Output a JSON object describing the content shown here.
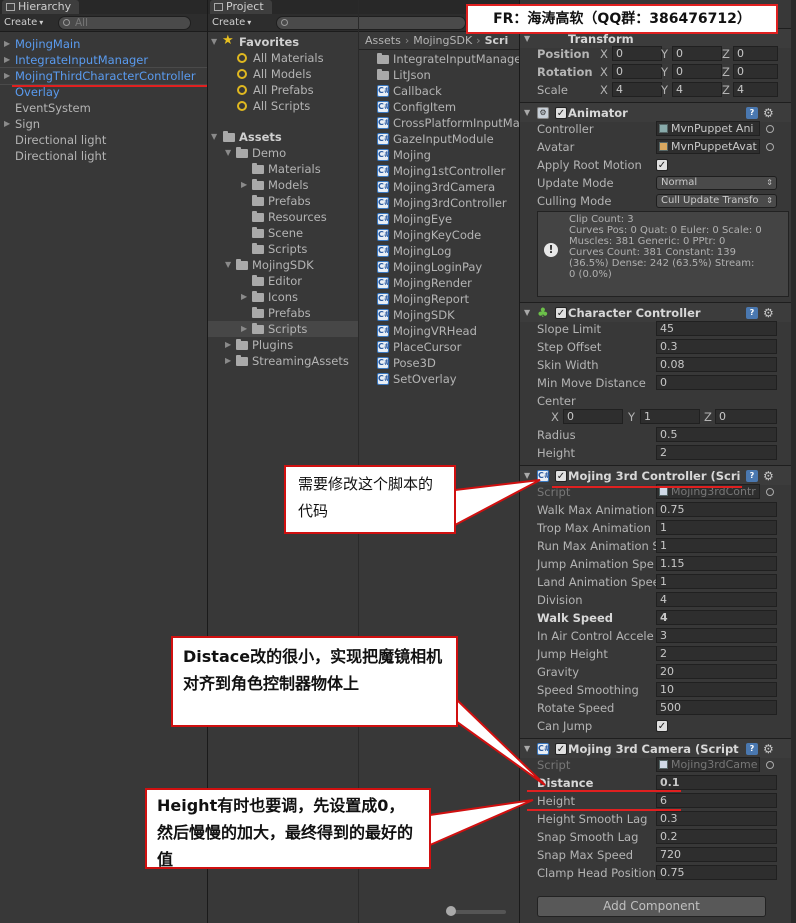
{
  "hierarchy": {
    "tab_label": "Hierarchy",
    "create_label": "Create",
    "search_placeholder": "All",
    "items": [
      {
        "label": "MojingMain",
        "color": "#5a9bef",
        "foldable": true
      },
      {
        "label": "IntegrateInputManager",
        "color": "#5a9bef",
        "foldable": true
      },
      {
        "label": "MojingThirdCharacterController",
        "color": "#5a9bef",
        "foldable": true,
        "selected": true
      },
      {
        "label": "Overlay",
        "color": "#5a9bef",
        "foldable": false
      },
      {
        "label": "EventSystem",
        "color": "#b4b4b4",
        "foldable": false
      },
      {
        "label": "Sign",
        "color": "#b4b4b4",
        "foldable": true
      },
      {
        "label": "Directional light",
        "color": "#b4b4b4",
        "foldable": false
      },
      {
        "label": "Directional light",
        "color": "#b4b4b4",
        "foldable": false
      }
    ]
  },
  "project": {
    "tab_label": "Project",
    "create_label": "Create",
    "favorites_label": "Favorites",
    "favorites": [
      "All Materials",
      "All Models",
      "All Prefabs",
      "All Scripts"
    ],
    "assets_label": "Assets",
    "tree": [
      {
        "label": "Demo",
        "level": 1,
        "expanded": true
      },
      {
        "label": "Materials",
        "level": 2
      },
      {
        "label": "Models",
        "level": 2,
        "foldable": true
      },
      {
        "label": "Prefabs",
        "level": 2
      },
      {
        "label": "Resources",
        "level": 2
      },
      {
        "label": "Scene",
        "level": 2
      },
      {
        "label": "Scripts",
        "level": 2
      },
      {
        "label": "MojingSDK",
        "level": 1,
        "expanded": true
      },
      {
        "label": "Editor",
        "level": 2
      },
      {
        "label": "Icons",
        "level": 2,
        "foldable": true
      },
      {
        "label": "Prefabs",
        "level": 2
      },
      {
        "label": "Scripts",
        "level": 2,
        "foldable": true,
        "selected": true
      },
      {
        "label": "Plugins",
        "level": 1,
        "foldable": true
      },
      {
        "label": "StreamingAssets",
        "level": 1,
        "foldable": true
      }
    ],
    "breadcrumb": [
      "Assets",
      "MojingSDK",
      "Scri"
    ],
    "files": [
      {
        "label": "IntegrateInputManage",
        "kind": "folder"
      },
      {
        "label": "LitJson",
        "kind": "folder"
      },
      {
        "label": "Callback",
        "kind": "script"
      },
      {
        "label": "ConfigItem",
        "kind": "script"
      },
      {
        "label": "CrossPlatformInputMa",
        "kind": "script"
      },
      {
        "label": "GazeInputModule",
        "kind": "script"
      },
      {
        "label": "Mojing",
        "kind": "script"
      },
      {
        "label": "Mojing1stController",
        "kind": "script"
      },
      {
        "label": "Mojing3rdCamera",
        "kind": "script"
      },
      {
        "label": "Mojing3rdController",
        "kind": "script"
      },
      {
        "label": "MojingEye",
        "kind": "script"
      },
      {
        "label": "MojingKeyCode",
        "kind": "script"
      },
      {
        "label": "MojingLog",
        "kind": "script"
      },
      {
        "label": "MojingLoginPay",
        "kind": "script"
      },
      {
        "label": "MojingRender",
        "kind": "script"
      },
      {
        "label": "MojingReport",
        "kind": "script"
      },
      {
        "label": "MojingSDK",
        "kind": "script"
      },
      {
        "label": "MojingVRHead",
        "kind": "script"
      },
      {
        "label": "PlaceCursor",
        "kind": "script"
      },
      {
        "label": "Pose3D",
        "kind": "script"
      },
      {
        "label": "SetOverlay",
        "kind": "script"
      }
    ]
  },
  "inspector": {
    "transform": {
      "title": "Transform",
      "position": {
        "label": "Position",
        "x": "0",
        "y": "0",
        "z": "0"
      },
      "rotation": {
        "label": "Rotation",
        "x": "0",
        "y": "0",
        "z": "0"
      },
      "scale": {
        "label": "Scale",
        "x": "4",
        "y": "4",
        "z": "4"
      }
    },
    "animator": {
      "title": "Animator",
      "controller_label": "Controller",
      "controller_value": "MvnPuppet Ani",
      "avatar_label": "Avatar",
      "avatar_value": "MvnPuppetAvat",
      "apply_root_label": "Apply Root Motion",
      "update_mode_label": "Update Mode",
      "update_mode_value": "Normal",
      "culling_mode_label": "Culling Mode",
      "culling_mode_value": "Cull Update Transfo",
      "info": "Clip Count: 3\nCurves Pos: 0 Quat: 0 Euler: 0 Scale: 0\nMuscles: 381 Generic: 0 PPtr: 0\nCurves Count: 381 Constant: 139\n(36.5%) Dense: 242 (63.5%) Stream:\n0 (0.0%)"
    },
    "character_controller": {
      "title": "Character Controller",
      "fields": [
        {
          "label": "Slope Limit",
          "value": "45"
        },
        {
          "label": "Step Offset",
          "value": "0.3"
        },
        {
          "label": "Skin Width",
          "value": "0.08"
        },
        {
          "label": "Min Move Distance",
          "value": "0"
        }
      ],
      "center_label": "Center",
      "center": {
        "x": "0",
        "y": "1",
        "z": "0"
      },
      "fields2": [
        {
          "label": "Radius",
          "value": "0.5"
        },
        {
          "label": "Height",
          "value": "2"
        }
      ]
    },
    "controller3rd": {
      "title": "Mojing 3rd Controller (Scri",
      "script_label": "Script",
      "script_value": "Mojing3rdContr",
      "fields": [
        {
          "label": "Walk Max Animation",
          "value": "0.75"
        },
        {
          "label": "Trop Max Animation",
          "value": "1"
        },
        {
          "label": "Run Max Animation S",
          "value": "1"
        },
        {
          "label": "Jump Animation Spe",
          "value": "1.15"
        },
        {
          "label": "Land Animation Spee",
          "value": "1"
        },
        {
          "label": "Division",
          "value": "4"
        },
        {
          "label": "Walk Speed",
          "value": "4",
          "bold": true
        },
        {
          "label": "In Air Control Accele",
          "value": "3"
        },
        {
          "label": "Jump Height",
          "value": "2"
        },
        {
          "label": "Gravity",
          "value": "20"
        },
        {
          "label": "Speed Smoothing",
          "value": "10"
        },
        {
          "label": "Rotate Speed",
          "value": "500"
        }
      ],
      "can_jump_label": "Can Jump"
    },
    "camera3rd": {
      "title": "Mojing 3rd Camera (Script",
      "script_label": "Script",
      "script_value": "Mojing3rdCame",
      "fields": [
        {
          "label": "Distance",
          "value": "0.1",
          "bold": true
        },
        {
          "label": "Height",
          "value": "6"
        },
        {
          "label": "Height Smooth Lag",
          "value": "0.3"
        },
        {
          "label": "Snap Smooth Lag",
          "value": "0.2"
        },
        {
          "label": "Snap Max Speed",
          "value": "720"
        },
        {
          "label": "Clamp Head Position",
          "value": "0.75"
        }
      ]
    },
    "add_component_label": "Add Component"
  },
  "annotations": {
    "header_note": "FR：海涛高软（QQ群：386476712）",
    "callout1": "需要修改这个脚本的代码",
    "callout2": "Distace改的很小，实现把魔镜相机对齐到角色控制器物体上",
    "callout3": "Height有时也要调，先设置成0，然后慢慢的加大，最终得到的最好的值"
  }
}
